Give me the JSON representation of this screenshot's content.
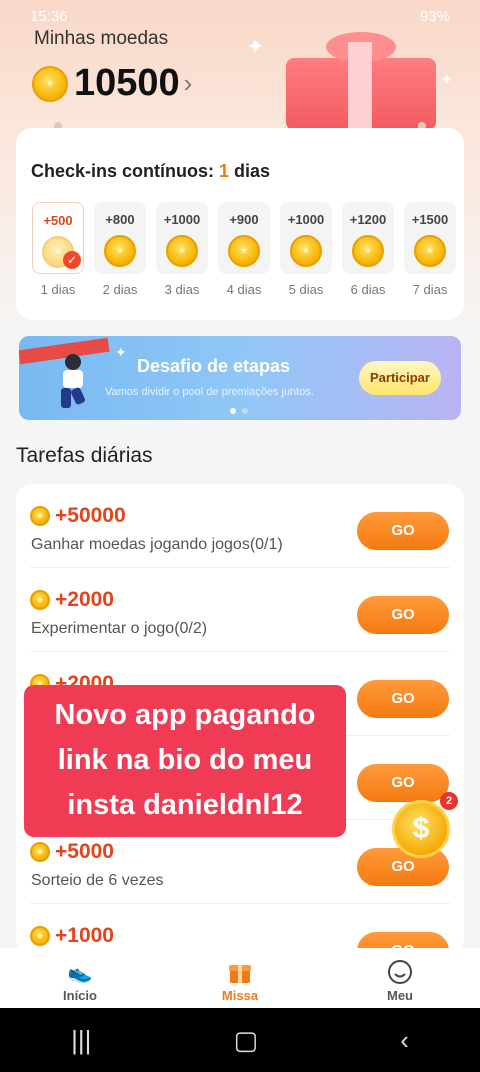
{
  "status": {
    "time": "15:36",
    "battery": "93%"
  },
  "header": {
    "title": "Minhas moedas",
    "balance": "10500",
    "chevron": "›"
  },
  "checkin": {
    "title_prefix": "Check-ins contínuos: ",
    "count": "1",
    "title_suffix": " dias",
    "days": [
      {
        "amount": "+500",
        "label": "1 dias"
      },
      {
        "amount": "+800",
        "label": "2 dias"
      },
      {
        "amount": "+1000",
        "label": "3 dias"
      },
      {
        "amount": "+900",
        "label": "4 dias"
      },
      {
        "amount": "+1000",
        "label": "5 dias"
      },
      {
        "amount": "+1200",
        "label": "6 dias"
      },
      {
        "amount": "+1500",
        "label": "7 dias"
      }
    ]
  },
  "banner": {
    "title": "Desafio de etapas",
    "subtitle": "Vamos dividir o pool de premiações juntos.",
    "button": "Participar"
  },
  "daily": {
    "heading": "Tarefas diárias",
    "tasks": [
      {
        "reward": "+50000",
        "desc": "Ganhar moedas jogando jogos(0/1)",
        "button": "GO"
      },
      {
        "reward": "+2000",
        "desc": "Experimentar o jogo(0/2)",
        "button": "GO"
      },
      {
        "reward": "+2000",
        "desc": "",
        "button": "GO"
      },
      {
        "reward": "",
        "desc": "",
        "button": "GO"
      },
      {
        "reward": "+5000",
        "desc": "Sorteio de 6 vezes",
        "button": "GO"
      },
      {
        "reward": "+1000",
        "desc": "",
        "button": "GO"
      }
    ]
  },
  "overlay": {
    "line1": "Novo app pagando",
    "line2": "link na bio do meu",
    "line3": "insta danieldnl12"
  },
  "floating": {
    "badge": "2",
    "symbol": "$"
  },
  "tabbar": {
    "items": [
      {
        "label": "Início",
        "icon": "sneaker-icon"
      },
      {
        "label": "Missa",
        "icon": "gift-icon"
      },
      {
        "label": "Meu",
        "icon": "smiley-icon"
      }
    ]
  }
}
